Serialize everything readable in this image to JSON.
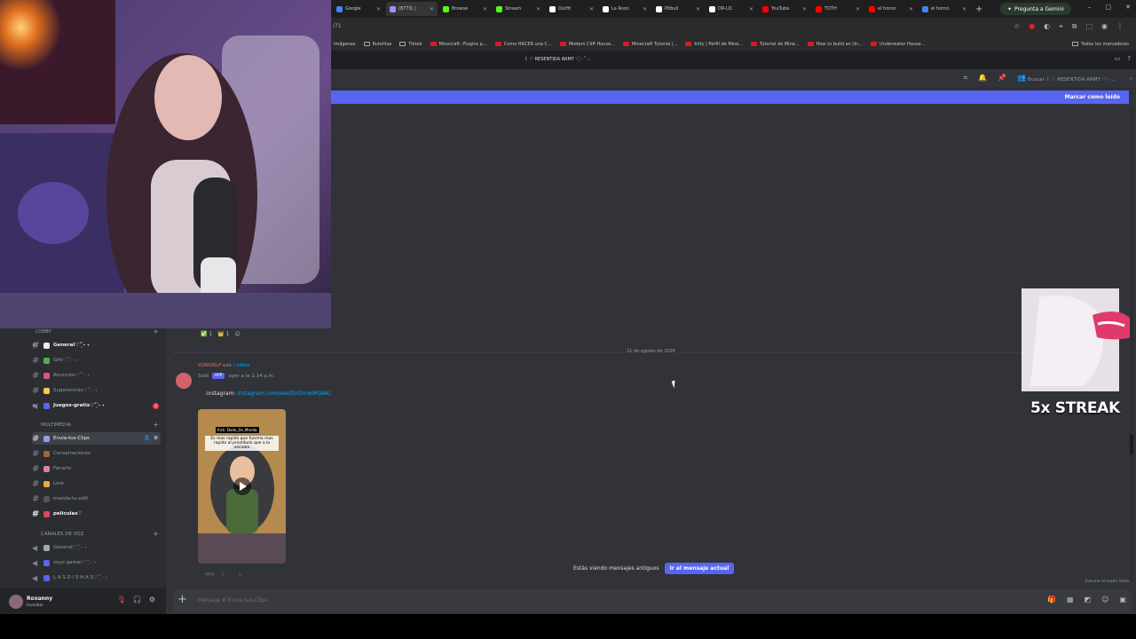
{
  "browser": {
    "tabs": [
      {
        "label": "Google",
        "color": "#4285f4"
      },
      {
        "label": "(8773) |",
        "color": "#a78bfa"
      },
      {
        "label": "Browse",
        "color": "#53fc18"
      },
      {
        "label": "Stream",
        "color": "#53fc18"
      },
      {
        "label": "Outfit",
        "color": "#ffffff"
      },
      {
        "label": "La Roon",
        "color": "#ffffff"
      },
      {
        "label": "Pitbull",
        "color": "#ffffff"
      },
      {
        "label": "DR-LIC",
        "color": "#ffffff"
      },
      {
        "label": "YouTube",
        "color": "#ff0000"
      },
      {
        "label": "TOTH",
        "color": "#ff0000"
      },
      {
        "label": "el horno",
        "color": "#ff0000"
      },
      {
        "label": "el horno",
        "color": "#4285f4"
      }
    ],
    "new_tab": "+",
    "gemini_label": "Pregunta a Gemini",
    "window_controls": [
      "–",
      "▢",
      "✕"
    ],
    "url": "/71",
    "bookmarks": [
      {
        "label": "Imágenes",
        "kind": "none"
      },
      {
        "label": "Ruletitas",
        "kind": "folder"
      },
      {
        "label": "Tiktok",
        "kind": "folder"
      },
      {
        "label": "Minecraft: Plugins p...",
        "kind": "yt"
      },
      {
        "label": "Como HACER una C...",
        "kind": "yt"
      },
      {
        "label": "Modern Cliff House...",
        "kind": "yt"
      },
      {
        "label": "Minecraft Tutorial |...",
        "kind": "yt"
      },
      {
        "label": "kitty | Perfil de Mine...",
        "kind": "yt"
      },
      {
        "label": "Tutorial de Mine...",
        "kind": "yt"
      },
      {
        "label": "How to build an Un...",
        "kind": "yt"
      },
      {
        "label": "Underwater House...",
        "kind": "yt"
      }
    ],
    "all_bookmarks": "Todos los marcadores"
  },
  "discord": {
    "server_name": "꒰ ♡ RESENTIDA ARMY ♡ ̖́- ˚ ₊",
    "search_placeholder": "Buscar ꒰ ♡ RESENTIDA ARMY ♡ ̖́- ...",
    "new_messages_bar": "Marcar como leído",
    "sidebar": {
      "categories": [
        {
          "label": "LOBBY"
        },
        {
          "label": "MULTIMEDIA"
        },
        {
          "label": "CANALES DE VOZ"
        }
      ],
      "channels": [
        {
          "label": "General♡˚ ̖́- ₊",
          "bold": true
        },
        {
          "label": "Gifs♡˚ ̖́- ₊"
        },
        {
          "label": "Anuncios♡˚ ̖́- ₊"
        },
        {
          "label": "Sugerencias♡˚ ̖́- ₊"
        },
        {
          "label": "Juegos-gratis♡˚ ̖́- ₊",
          "bold": true,
          "badge": "3"
        },
        {
          "label": "Envia-tus-Clips",
          "selected": true
        },
        {
          "label": "Conspiraciones"
        },
        {
          "label": "Fanarts"
        },
        {
          "label": "Lore"
        },
        {
          "label": "manda-tu-edit"
        },
        {
          "label": "peliculas♡",
          "bold": true
        },
        {
          "label": "General♡˚ ̖́- ₊"
        },
        {
          "label": "zoyo gamer♡˚ ̖́- ₊"
        },
        {
          "label": "L A S D I S H A S♡˚ ̖́- ₊"
        }
      ]
    },
    "user": {
      "name": "Roxanny",
      "status": "Invisible"
    },
    "reactions": [
      {
        "emoji": "✅",
        "count": "1"
      },
      {
        "emoji": "👑",
        "count": "1"
      }
    ],
    "date_divider": "21 de agosto de 2026",
    "message": {
      "reply_name": "KONORLP",
      "reply_used": "usó",
      "reply_command": "/ video",
      "author": "Sodi",
      "app_tag": "APP",
      "timestamp": "ayer a la 1:14 a.m.",
      "text_prefix": ":instagram:",
      "link": "instagram.com/reel/DcOmw9RjiAK/",
      "video_top_caption": "Kick: Dodo_De_Mierda",
      "video_caption": "Es mas rapido que fuerma mas rapido al prostibulo que a la escuela",
      "footer": "MP4"
    },
    "jump": {
      "text": "Estás viendo mensajes antiguos",
      "button": "Ir al mensaje actual"
    },
    "slowmode": "Inmune al modo lento",
    "composer_placeholder": "Mensaje #  Envia-tus-Clips"
  },
  "overlay": {
    "streak": "5x STREAK"
  }
}
